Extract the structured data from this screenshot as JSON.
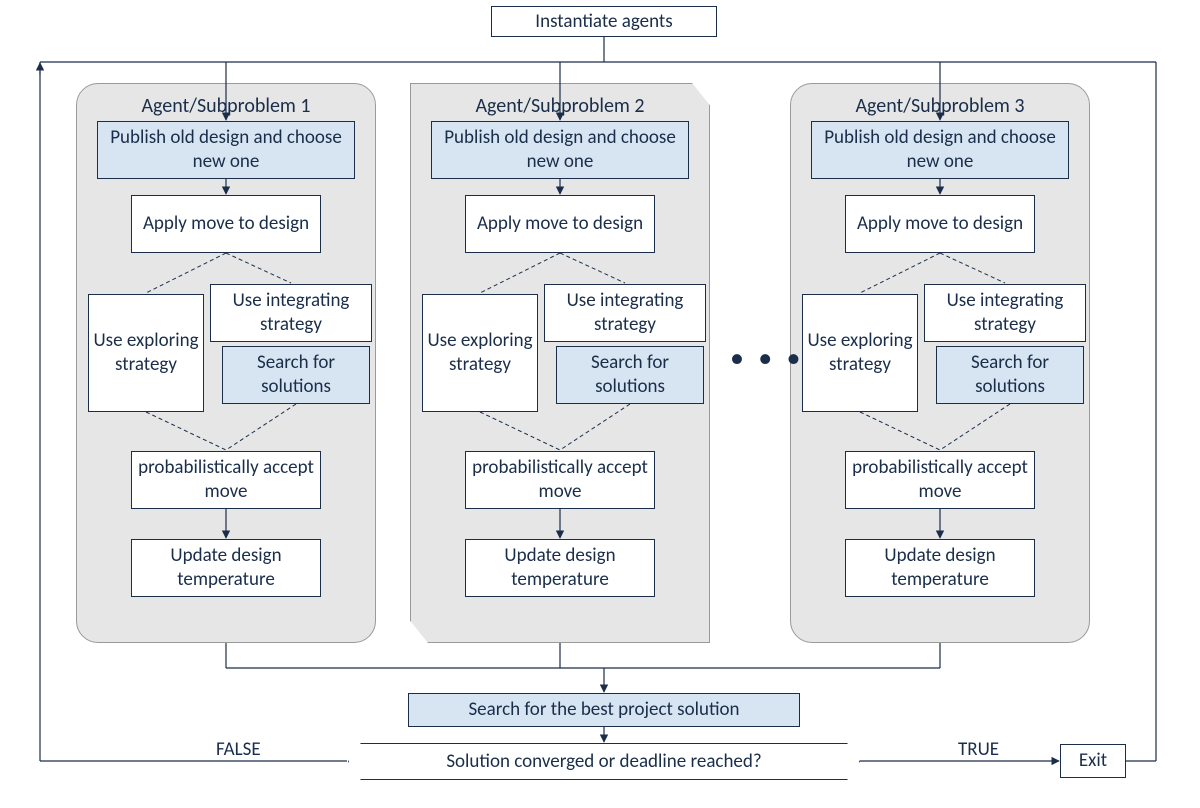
{
  "top": {
    "instantiate": "Instantiate agents"
  },
  "agents": [
    {
      "title": "Agent/Subproblem 1"
    },
    {
      "title": "Agent/Subproblem 2"
    },
    {
      "title": "Agent/Subproblem 3"
    }
  ],
  "agent_boxes": {
    "publish": "Publish old design and choose new one",
    "apply": "Apply move to design",
    "explore": "Use exploring strategy",
    "integrate": "Use integrating strategy",
    "search": "Search for solutions",
    "accept": "probabilistically accept move",
    "update": "Update design temperature"
  },
  "bottom": {
    "search_best": "Search for the best project solution",
    "decision": "Solution converged or deadline reached?",
    "false": "FALSE",
    "true": "TRUE",
    "exit": "Exit"
  },
  "ellipsis": "• • •"
}
